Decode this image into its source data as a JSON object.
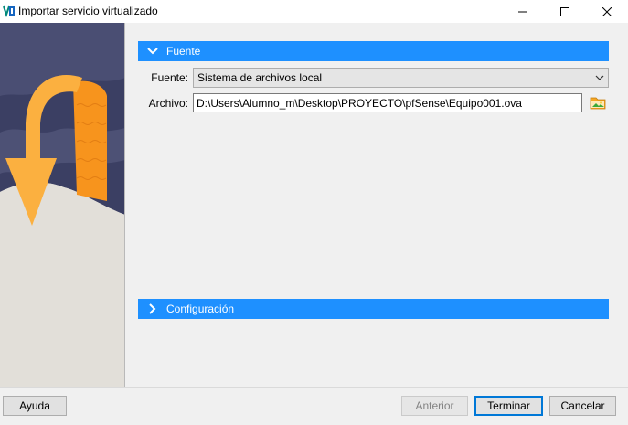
{
  "window": {
    "title": "Importar servicio virtualizado",
    "controls": {
      "minimize_icon": "minimize-icon",
      "maximize_icon": "maximize-icon",
      "close_icon": "close-icon"
    }
  },
  "sections": {
    "fuente": {
      "label": "Fuente",
      "expanded": true
    },
    "configuracion": {
      "label": "Configuración",
      "expanded": false
    }
  },
  "form": {
    "fuente_label": "Fuente:",
    "fuente_value": "Sistema de archivos local",
    "archivo_label": "Archivo:",
    "archivo_value": "D:\\Users\\Alumno_m\\Desktop\\PROYECTO\\pfSense\\Equipo001.ova"
  },
  "footer": {
    "help_label": "Ayuda",
    "prev_label": "Anterior",
    "finish_label": "Terminar",
    "cancel_label": "Cancelar"
  },
  "colors": {
    "section_header": "#1e90ff",
    "banner_dark": "#3b3f63",
    "banner_light": "#e2dfd9",
    "arrow_orange": "#f7941d",
    "arrow_yellow": "#fbb040"
  }
}
